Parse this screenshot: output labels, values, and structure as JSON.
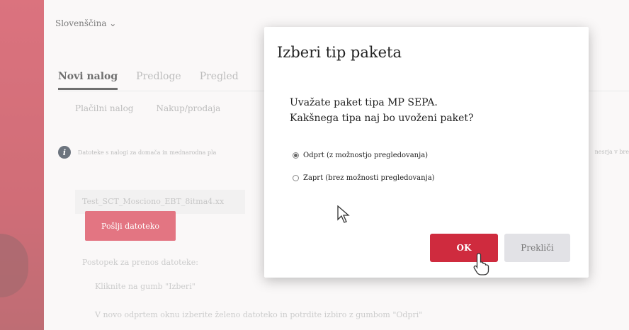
{
  "background": {
    "language": "Slovenščina ⌄",
    "tabs": [
      {
        "label": "Novi nalog",
        "active": true
      },
      {
        "label": "Predloge",
        "active": false
      },
      {
        "label": "Pregled",
        "active": false
      }
    ],
    "subtabs": [
      "Plačilni nalog",
      "Nakup/prodaja"
    ],
    "info_text": "Datoteke s nalogi za domača in mednarodna pla",
    "info_text_right": "nesrja v bre",
    "file_name": "Test_SCT_Mosciono_EBT_8itma4.xx",
    "send_button": "Pošlji datoteko",
    "instructions_title": "Postopek za prenos datoteke:",
    "instruction_1": "Kliknite na gumb \"Izberi\"",
    "instruction_2": "V novo odprtem oknu izberite želeno datoteko in potrdite izbiro z gumbom \"Odpri\""
  },
  "modal": {
    "title": "Izberi tip paketa",
    "message_line1": "Uvažate paket tipa MP SEPA.",
    "message_line2": "Kakšnega tipa naj bo uvoženi paket?",
    "option_open": "Odprt (z možnostjo pregledovanja)",
    "option_closed": "Zaprt (brez možnosti pregledovanja)",
    "selected_option": "open",
    "ok_label": "OK",
    "cancel_label": "Prekliči"
  },
  "colors": {
    "brand_red": "#cf2b3e",
    "cancel_gray": "#e2e2e6"
  }
}
